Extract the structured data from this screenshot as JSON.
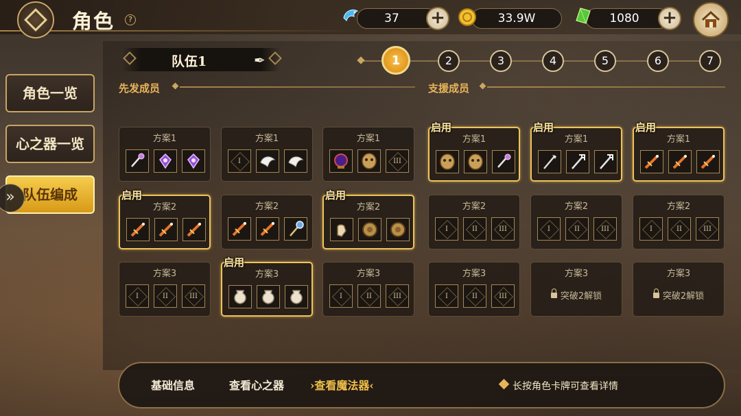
{
  "header": {
    "title": "角色",
    "help": "?",
    "resources": [
      {
        "name": "blue-fish-currency",
        "value": "37"
      },
      {
        "name": "gold-coin-currency",
        "value": "33.9W"
      },
      {
        "name": "green-crystal-currency",
        "value": "1080"
      }
    ]
  },
  "sidebar": {
    "items": [
      {
        "label": "角色一览",
        "active": false
      },
      {
        "label": "心之器一览",
        "active": false
      },
      {
        "label": "队伍编成",
        "active": true
      }
    ]
  },
  "team": {
    "name": "队伍1",
    "pages": [
      "1",
      "2",
      "3",
      "4",
      "5",
      "6",
      "7"
    ],
    "active_page": "1"
  },
  "sections": {
    "starters": "先发成员",
    "support": "支援成员"
  },
  "active_tag": "启用",
  "cards": [
    [
      {
        "label": "方案1",
        "active": false,
        "slots": [
          "wand-icon",
          "amulet-icon",
          "amulet-icon"
        ]
      },
      {
        "label": "方案1",
        "active": false,
        "slots": [
          "I",
          "bird-icon",
          "bird-icon"
        ]
      },
      {
        "label": "方案1",
        "active": false,
        "slots": [
          "orb-icon",
          "mask-icon",
          "III"
        ]
      },
      {
        "label": "方案1",
        "active": true,
        "slots": [
          "mask-icon",
          "mask-icon",
          "wand-icon"
        ]
      },
      {
        "label": "方案1",
        "active": true,
        "slots": [
          "staff-icon",
          "trident-icon",
          "trident-icon"
        ]
      },
      {
        "label": "方案1",
        "active": true,
        "slots": [
          "sword-icon",
          "sword-icon",
          "sword-icon"
        ]
      }
    ],
    [
      {
        "label": "方案2",
        "active": true,
        "slots": [
          "sword-icon",
          "sword-icon",
          "sword-icon"
        ]
      },
      {
        "label": "方案2",
        "active": false,
        "slots": [
          "sword-icon",
          "sword-icon",
          "scepter-icon"
        ]
      },
      {
        "label": "方案2",
        "active": true,
        "slots": [
          "gauntlet-icon",
          "shield-icon",
          "shield-icon"
        ]
      },
      {
        "label": "方案2",
        "active": false,
        "slots": [
          "I",
          "II",
          "III"
        ]
      },
      {
        "label": "方案2",
        "active": false,
        "slots": [
          "I",
          "II",
          "III"
        ]
      },
      {
        "label": "方案2",
        "active": false,
        "slots": [
          "I",
          "II",
          "III"
        ]
      }
    ],
    [
      {
        "label": "方案3",
        "active": false,
        "slots": [
          "I",
          "II",
          "III"
        ]
      },
      {
        "label": "方案3",
        "active": true,
        "slots": [
          "urn-icon",
          "urn-icon",
          "urn-icon"
        ]
      },
      {
        "label": "方案3",
        "active": false,
        "slots": [
          "I",
          "II",
          "III"
        ]
      },
      {
        "label": "方案3",
        "active": false,
        "slots": [
          "I",
          "II",
          "III"
        ]
      },
      {
        "label": "方案3",
        "active": false,
        "locked": "突破2解锁"
      },
      {
        "label": "方案3",
        "active": false,
        "locked": "突破2解锁"
      }
    ]
  ],
  "bottom": {
    "tabs": [
      {
        "label": "基础信息",
        "active": false
      },
      {
        "label": "查看心之器",
        "active": false
      },
      {
        "label": "查看魔法器",
        "active": true
      }
    ],
    "hint": "长按角色卡牌可查看详情"
  },
  "colors": {
    "accent": "#f0c45a",
    "gold_border": "#c9a664",
    "panel": "#261e18"
  }
}
